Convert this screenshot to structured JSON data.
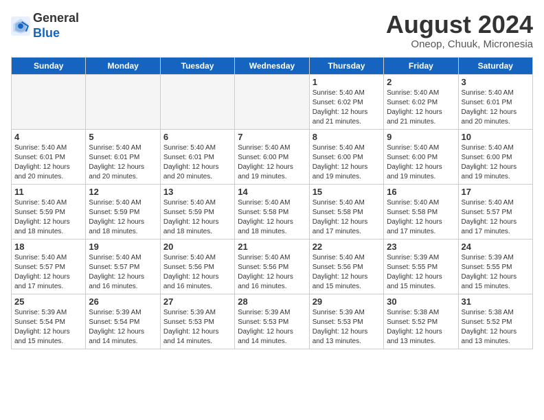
{
  "header": {
    "logo_line1": "General",
    "logo_line2": "Blue",
    "title": "August 2024",
    "subtitle": "Oneop, Chuuk, Micronesia"
  },
  "weekdays": [
    "Sunday",
    "Monday",
    "Tuesday",
    "Wednesday",
    "Thursday",
    "Friday",
    "Saturday"
  ],
  "weeks": [
    [
      {
        "day": "",
        "empty": true
      },
      {
        "day": "",
        "empty": true
      },
      {
        "day": "",
        "empty": true
      },
      {
        "day": "",
        "empty": true
      },
      {
        "day": "1",
        "sunrise": "5:40 AM",
        "sunset": "6:02 PM",
        "daylight": "12 hours and 21 minutes."
      },
      {
        "day": "2",
        "sunrise": "5:40 AM",
        "sunset": "6:02 PM",
        "daylight": "12 hours and 21 minutes."
      },
      {
        "day": "3",
        "sunrise": "5:40 AM",
        "sunset": "6:01 PM",
        "daylight": "12 hours and 20 minutes."
      }
    ],
    [
      {
        "day": "4",
        "sunrise": "5:40 AM",
        "sunset": "6:01 PM",
        "daylight": "12 hours and 20 minutes."
      },
      {
        "day": "5",
        "sunrise": "5:40 AM",
        "sunset": "6:01 PM",
        "daylight": "12 hours and 20 minutes."
      },
      {
        "day": "6",
        "sunrise": "5:40 AM",
        "sunset": "6:01 PM",
        "daylight": "12 hours and 20 minutes."
      },
      {
        "day": "7",
        "sunrise": "5:40 AM",
        "sunset": "6:00 PM",
        "daylight": "12 hours and 19 minutes."
      },
      {
        "day": "8",
        "sunrise": "5:40 AM",
        "sunset": "6:00 PM",
        "daylight": "12 hours and 19 minutes."
      },
      {
        "day": "9",
        "sunrise": "5:40 AM",
        "sunset": "6:00 PM",
        "daylight": "12 hours and 19 minutes."
      },
      {
        "day": "10",
        "sunrise": "5:40 AM",
        "sunset": "6:00 PM",
        "daylight": "12 hours and 19 minutes."
      }
    ],
    [
      {
        "day": "11",
        "sunrise": "5:40 AM",
        "sunset": "5:59 PM",
        "daylight": "12 hours and 18 minutes."
      },
      {
        "day": "12",
        "sunrise": "5:40 AM",
        "sunset": "5:59 PM",
        "daylight": "12 hours and 18 minutes."
      },
      {
        "day": "13",
        "sunrise": "5:40 AM",
        "sunset": "5:59 PM",
        "daylight": "12 hours and 18 minutes."
      },
      {
        "day": "14",
        "sunrise": "5:40 AM",
        "sunset": "5:58 PM",
        "daylight": "12 hours and 18 minutes."
      },
      {
        "day": "15",
        "sunrise": "5:40 AM",
        "sunset": "5:58 PM",
        "daylight": "12 hours and 17 minutes."
      },
      {
        "day": "16",
        "sunrise": "5:40 AM",
        "sunset": "5:58 PM",
        "daylight": "12 hours and 17 minutes."
      },
      {
        "day": "17",
        "sunrise": "5:40 AM",
        "sunset": "5:57 PM",
        "daylight": "12 hours and 17 minutes."
      }
    ],
    [
      {
        "day": "18",
        "sunrise": "5:40 AM",
        "sunset": "5:57 PM",
        "daylight": "12 hours and 17 minutes."
      },
      {
        "day": "19",
        "sunrise": "5:40 AM",
        "sunset": "5:57 PM",
        "daylight": "12 hours and 16 minutes."
      },
      {
        "day": "20",
        "sunrise": "5:40 AM",
        "sunset": "5:56 PM",
        "daylight": "12 hours and 16 minutes."
      },
      {
        "day": "21",
        "sunrise": "5:40 AM",
        "sunset": "5:56 PM",
        "daylight": "12 hours and 16 minutes."
      },
      {
        "day": "22",
        "sunrise": "5:40 AM",
        "sunset": "5:56 PM",
        "daylight": "12 hours and 15 minutes."
      },
      {
        "day": "23",
        "sunrise": "5:39 AM",
        "sunset": "5:55 PM",
        "daylight": "12 hours and 15 minutes."
      },
      {
        "day": "24",
        "sunrise": "5:39 AM",
        "sunset": "5:55 PM",
        "daylight": "12 hours and 15 minutes."
      }
    ],
    [
      {
        "day": "25",
        "sunrise": "5:39 AM",
        "sunset": "5:54 PM",
        "daylight": "12 hours and 15 minutes."
      },
      {
        "day": "26",
        "sunrise": "5:39 AM",
        "sunset": "5:54 PM",
        "daylight": "12 hours and 14 minutes."
      },
      {
        "day": "27",
        "sunrise": "5:39 AM",
        "sunset": "5:53 PM",
        "daylight": "12 hours and 14 minutes."
      },
      {
        "day": "28",
        "sunrise": "5:39 AM",
        "sunset": "5:53 PM",
        "daylight": "12 hours and 14 minutes."
      },
      {
        "day": "29",
        "sunrise": "5:39 AM",
        "sunset": "5:53 PM",
        "daylight": "12 hours and 13 minutes."
      },
      {
        "day": "30",
        "sunrise": "5:38 AM",
        "sunset": "5:52 PM",
        "daylight": "12 hours and 13 minutes."
      },
      {
        "day": "31",
        "sunrise": "5:38 AM",
        "sunset": "5:52 PM",
        "daylight": "12 hours and 13 minutes."
      }
    ]
  ]
}
